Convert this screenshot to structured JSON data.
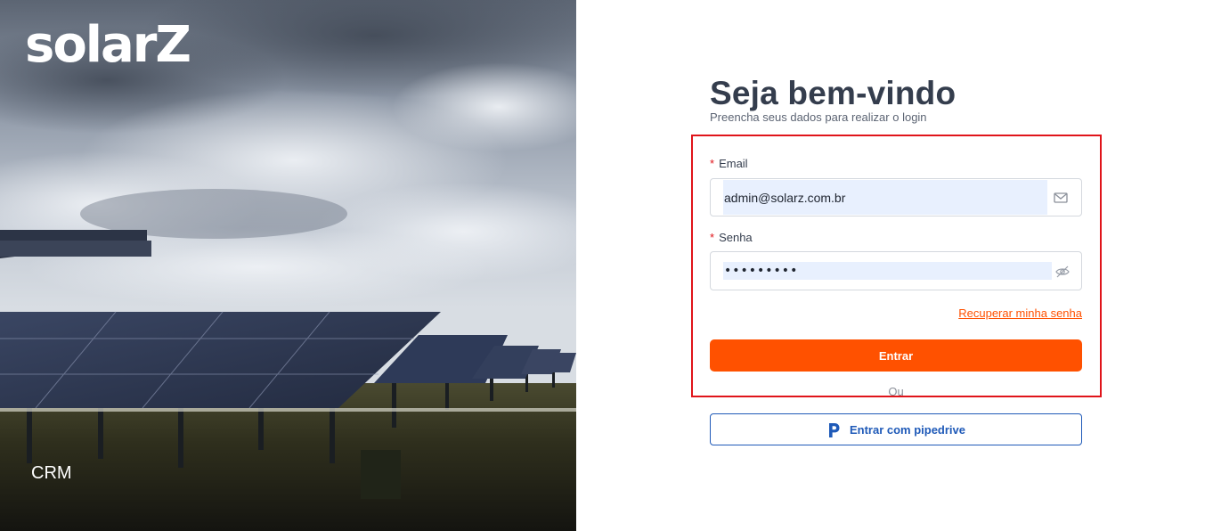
{
  "hero": {
    "logo_text": "solarZ",
    "caption": "CRM"
  },
  "form": {
    "title": "Seja bem-vindo",
    "subtitle": "Preencha seus dados para realizar o login",
    "email": {
      "required_mark": "*",
      "label": "Email",
      "value": "admin@solarz.com.br",
      "icon": "mail-icon"
    },
    "password": {
      "required_mark": "*",
      "label": "Senha",
      "value": "•••••••••",
      "icon": "eye-off-icon"
    },
    "forgot_link": "Recuperar minha senha",
    "submit_label": "Entrar",
    "divider_text": "Ou",
    "pipedrive_label": "Entrar com pipedrive",
    "pipedrive_icon": "pipedrive-logo-icon"
  },
  "colors": {
    "accent": "#ff5100",
    "link": "#ff5000",
    "pipedrive_blue": "#1f5ab8",
    "title": "#343d4d",
    "highlight_border": "#e0141a",
    "autofill_bg": "#e8f0fe"
  }
}
